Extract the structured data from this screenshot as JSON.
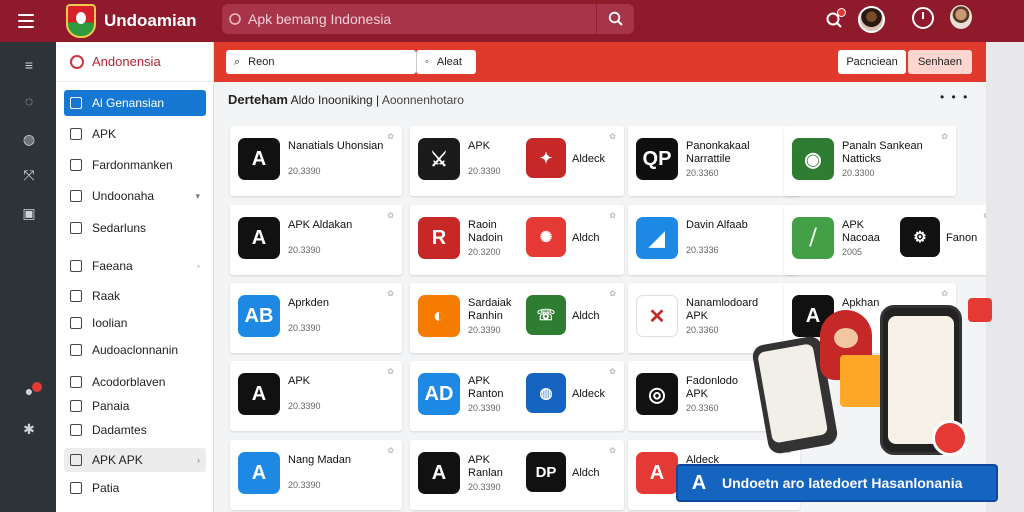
{
  "header": {
    "app_title": "Undoamian",
    "search_placeholder": "Apk bemang Indonesia",
    "brand_color": "#8e1a2c"
  },
  "sidebar": {
    "heading": "Andonensia",
    "items": [
      {
        "label": "Al Genansian",
        "icon": "document-icon",
        "active": true
      },
      {
        "label": "APK",
        "icon": "apk-icon"
      },
      {
        "label": "Fardonmanken",
        "icon": "user-icon"
      },
      {
        "label": "Undoonaha",
        "icon": "globe-icon",
        "chevron": "▾"
      },
      {
        "label": "Sedarluns",
        "icon": "lock-icon"
      },
      {
        "label": "Faeana",
        "icon": "folder-icon",
        "chevron": "◦"
      },
      {
        "label": "Raak",
        "icon": "car-icon"
      },
      {
        "label": "Ioolian",
        "icon": "pen-icon"
      },
      {
        "label": "Audoaclonnanin",
        "icon": "grid-icon"
      },
      {
        "label": "Acodorblaven",
        "icon": "person-icon"
      },
      {
        "label": "Panaia",
        "icon": "settings-icon"
      },
      {
        "label": "Dadamtes",
        "icon": "circle-icon"
      },
      {
        "label": "APK APK",
        "icon": "apk-icon",
        "chevron": "›"
      },
      {
        "label": "Patia",
        "icon": "search-icon"
      }
    ]
  },
  "toolbar": {
    "filter_placeholder": "Reon",
    "filter2_label": "Aleat",
    "button_a": "Pacnciean",
    "button_b": "Senhaen"
  },
  "breadcrumb": {
    "bold": "Derteham",
    "text": "Aldo Inooniking",
    "separator": "|",
    "dim": "Aoonnenhotaro"
  },
  "more_label": "• • •",
  "apps": [
    {
      "title": "Nanatials Uhonsian",
      "sub": "20.3390",
      "icon_text": "A",
      "bg": "#111111"
    },
    {
      "title": "APK",
      "sub": "20.3390",
      "icon_text": "⚔",
      "bg": "#1a1a1a",
      "title2": "Aldeck",
      "icon2": "✦",
      "bg2": "#c62828"
    },
    {
      "title": "Panonkakaal",
      "sub": "20.3360",
      "icon_text": "QP",
      "bg": "#0f0f0f",
      "subtitle": "Narrattile"
    },
    {
      "title": "Panaln Sankean",
      "sub": "20.3300",
      "icon_text": "◉",
      "bg": "#2e7d32",
      "subtitle": "Natticks"
    },
    {
      "title": "APK Aldakan",
      "sub": "20.3390",
      "icon_text": "A",
      "bg": "#111111"
    },
    {
      "title": "Raoin",
      "sub": "20.3200",
      "icon_text": "R",
      "bg": "#c62828",
      "title2": "Aldch",
      "icon2": "✺",
      "bg2": "#e53935",
      "subtitle": "Nadoin"
    },
    {
      "title": "Davin Alfaab",
      "sub": "20.3336",
      "icon_text": "◢",
      "bg": "#1e88e5"
    },
    {
      "title": "APK",
      "sub": "2005",
      "icon_text": "⧸",
      "bg": "#43a047",
      "title2": "Fanon",
      "icon2": "⚙",
      "bg2": "#111111",
      "subtitle": "Nacoaa"
    },
    {
      "title": "Aprkden",
      "sub": "20.3390",
      "icon_text": "AB",
      "bg": "#1e88e5"
    },
    {
      "title": "Sardaiak",
      "sub": "20.3390",
      "icon_text": "◐",
      "bg": "#f57c00",
      "title2": "Aldch",
      "icon2": "☏",
      "bg2": "#2e7d32",
      "subtitle": "Ranhin"
    },
    {
      "title": "Nanamlodoard",
      "sub": "20.3360",
      "icon_text": "✕",
      "bg": "#ffffff",
      "subtitle": "APK"
    },
    {
      "title": "Apkhan",
      "sub": "",
      "icon_text": "A",
      "bg": "#111111"
    },
    {
      "title": "APK",
      "sub": "20.3390",
      "icon_text": "A",
      "bg": "#111111"
    },
    {
      "title": "APK",
      "sub": "20.3390",
      "icon_text": "AD",
      "bg": "#1e88e5",
      "title2": "Aldeck",
      "icon2": "◍",
      "bg2": "#1565c0",
      "subtitle": "Ranton"
    },
    {
      "title": "Fadonlodo",
      "sub": "20.3360",
      "icon_text": "◎",
      "bg": "#111111",
      "subtitle": "APK"
    },
    {
      "title": "Nang Madan",
      "sub": "20.3390",
      "icon_text": "A",
      "bg": "#1e88e5"
    },
    {
      "title": "APK",
      "sub": "20.3390",
      "icon_text": "A",
      "bg": "#111111",
      "title2": "Aldch",
      "icon2": "DP",
      "bg2": "#111111",
      "subtitle": "Ranlan"
    },
    {
      "title": "Aldeck",
      "sub": "",
      "icon_text": "A",
      "bg": "#e53935"
    }
  ],
  "promo": {
    "label": "Undoetn aro latedoert Hasanlonania",
    "icon_text": "A"
  }
}
